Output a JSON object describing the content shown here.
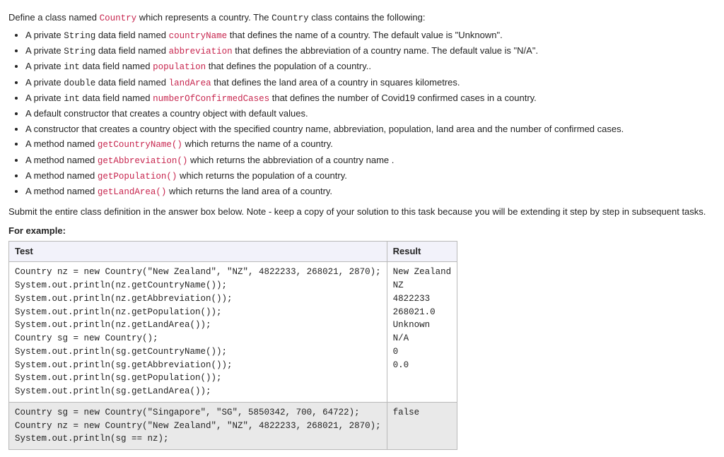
{
  "intro": {
    "prefix": "Define a class named ",
    "className": "Country",
    "middle": " which represents a country. The ",
    "classNameMono": "Country",
    "suffix": " class contains the following:"
  },
  "bullets": [
    {
      "pre": "A private ",
      "mono1": "String",
      "mid1": " data field named ",
      "kw": "countryName",
      "post": " that defines the name of a country. The default value is \"Unknown\"."
    },
    {
      "pre": "A private ",
      "mono1": "String",
      "mid1": " data field named ",
      "kw": "abbreviation",
      "post": " that defines the abbreviation of a country name. The default value is \"N/A\"."
    },
    {
      "pre": "A private ",
      "mono1": "int",
      "mid1": " data field named ",
      "kw": "population",
      "post": " that defines the population of a country.."
    },
    {
      "pre": "A private ",
      "mono1": "double",
      "mid1": " data field named ",
      "kw": "landArea",
      "post": " that defines the land area of a country in squares kilometres."
    },
    {
      "pre": "A private ",
      "mono1": "int",
      "mid1": " data field named ",
      "kw": "numberOfConfirmedCases",
      "post": " that defines the number of Covid19 confirmed cases in a country."
    },
    {
      "pre": "A default constructor that creates a country object with default values.",
      "mono1": "",
      "mid1": "",
      "kw": "",
      "post": ""
    },
    {
      "pre": "A constructor that creates a country object with the specified country name, abbreviation, population, land area and the number of confirmed cases.",
      "mono1": "",
      "mid1": "",
      "kw": "",
      "post": ""
    },
    {
      "pre": "A method named ",
      "mono1": "",
      "mid1": "",
      "kw": "getCountryName()",
      "post": " which returns the name of a country."
    },
    {
      "pre": "A method named ",
      "mono1": "",
      "mid1": "",
      "kw": "getAbbreviation()",
      "post": " which returns the abbreviation of a country name ."
    },
    {
      "pre": "A method named ",
      "mono1": "",
      "mid1": "",
      "kw": "getPopulation()",
      "post": " which returns the population of a country."
    },
    {
      "pre": "A method named ",
      "mono1": "",
      "mid1": "",
      "kw": "getLandArea()",
      "post": " which returns the land area of a country."
    }
  ],
  "submit": "Submit the entire class definition in the answer box below. Note - keep a copy of your solution to this task because you will be extending it step by step in subsequent tasks.",
  "forExample": "For example:",
  "table": {
    "headers": {
      "test": "Test",
      "result": "Result"
    },
    "rows": [
      {
        "test": "Country nz = new Country(\"New Zealand\", \"NZ\", 4822233, 268021, 2870);\nSystem.out.println(nz.getCountryName());\nSystem.out.println(nz.getAbbreviation());\nSystem.out.println(nz.getPopulation());\nSystem.out.println(nz.getLandArea());\nCountry sg = new Country();\nSystem.out.println(sg.getCountryName());\nSystem.out.println(sg.getAbbreviation());\nSystem.out.println(sg.getPopulation());\nSystem.out.println(sg.getLandArea());",
        "result": "New Zealand\nNZ\n4822233\n268021.0\nUnknown\nN/A\n0\n0.0"
      },
      {
        "test": "Country sg = new Country(\"Singapore\", \"SG\", 5850342, 700, 64722);\nCountry nz = new Country(\"New Zealand\", \"NZ\", 4822233, 268021, 2870);\nSystem.out.println(sg == nz);",
        "result": "false"
      }
    ]
  }
}
